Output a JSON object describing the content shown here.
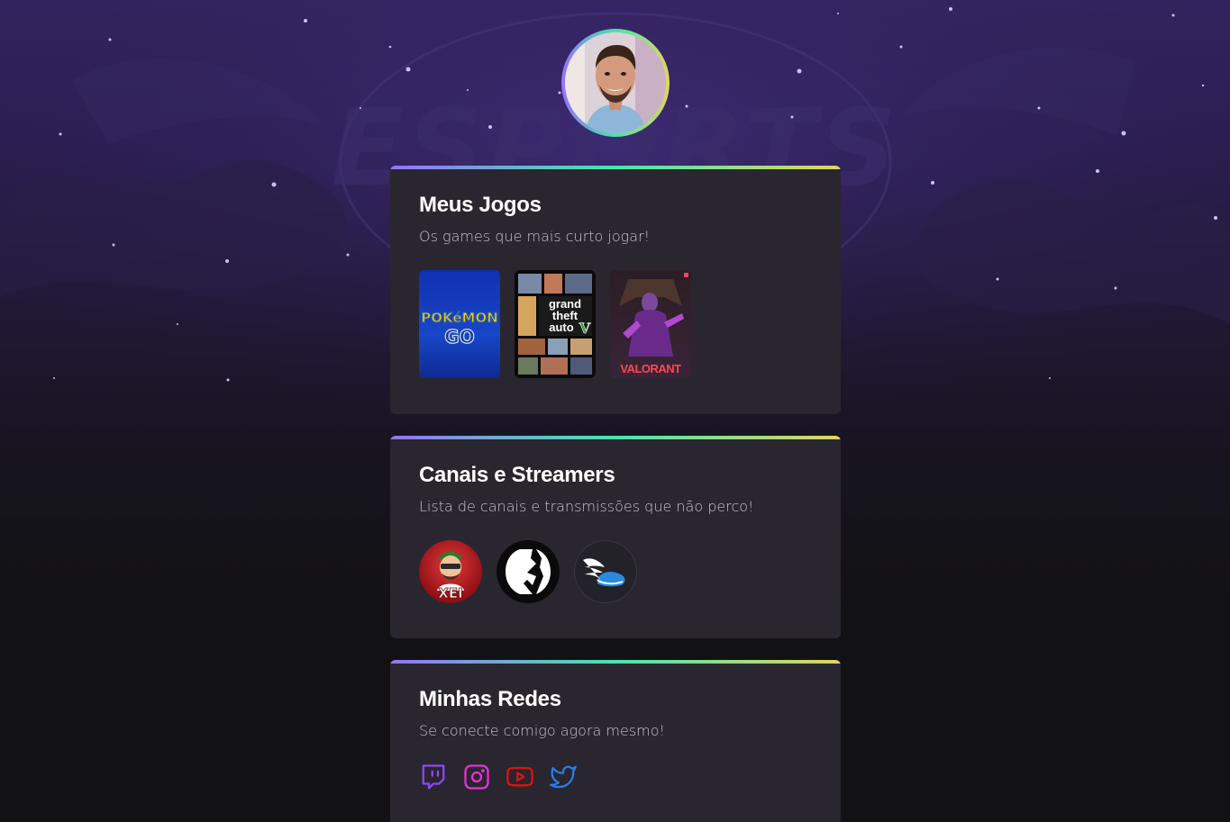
{
  "profile": {
    "avatar_icon": "person-avatar",
    "ring_gradient": [
      "#9572FC",
      "#43E7AD",
      "#E1D55D"
    ]
  },
  "background": {
    "watermark_text": "ESPORTS"
  },
  "games_section": {
    "title": "Meus Jogos",
    "subtitle": "Os games que mais curto jogar!",
    "games": [
      {
        "name": "Pokémon GO",
        "logo_line1": "POKéMON",
        "logo_line2": "GO"
      },
      {
        "name": "Grand Theft Auto V",
        "logo_words": [
          "grand",
          "theft",
          "auto"
        ],
        "logo_numeral": "V"
      },
      {
        "name": "Valorant",
        "logo_text": "VALORANT"
      }
    ]
  },
  "streamers_section": {
    "title": "Canais e Streamers",
    "subtitle": "Lista de canais e transmissões que não perco!",
    "streamers": [
      {
        "icon": "xei-channel-avatar",
        "label": "XEI"
      },
      {
        "icon": "black-channel-logo"
      },
      {
        "icon": "winged-shoe-logo"
      }
    ]
  },
  "social_section": {
    "title": "Minhas Redes",
    "subtitle": "Se conecte comigo agora mesmo!",
    "links": [
      {
        "icon": "twitch-icon",
        "color": "#9146FF"
      },
      {
        "icon": "instagram-icon",
        "color": "#E633D8"
      },
      {
        "icon": "youtube-icon",
        "color": "#E01212"
      },
      {
        "icon": "twitter-icon",
        "color": "#2D7DE6"
      }
    ]
  }
}
